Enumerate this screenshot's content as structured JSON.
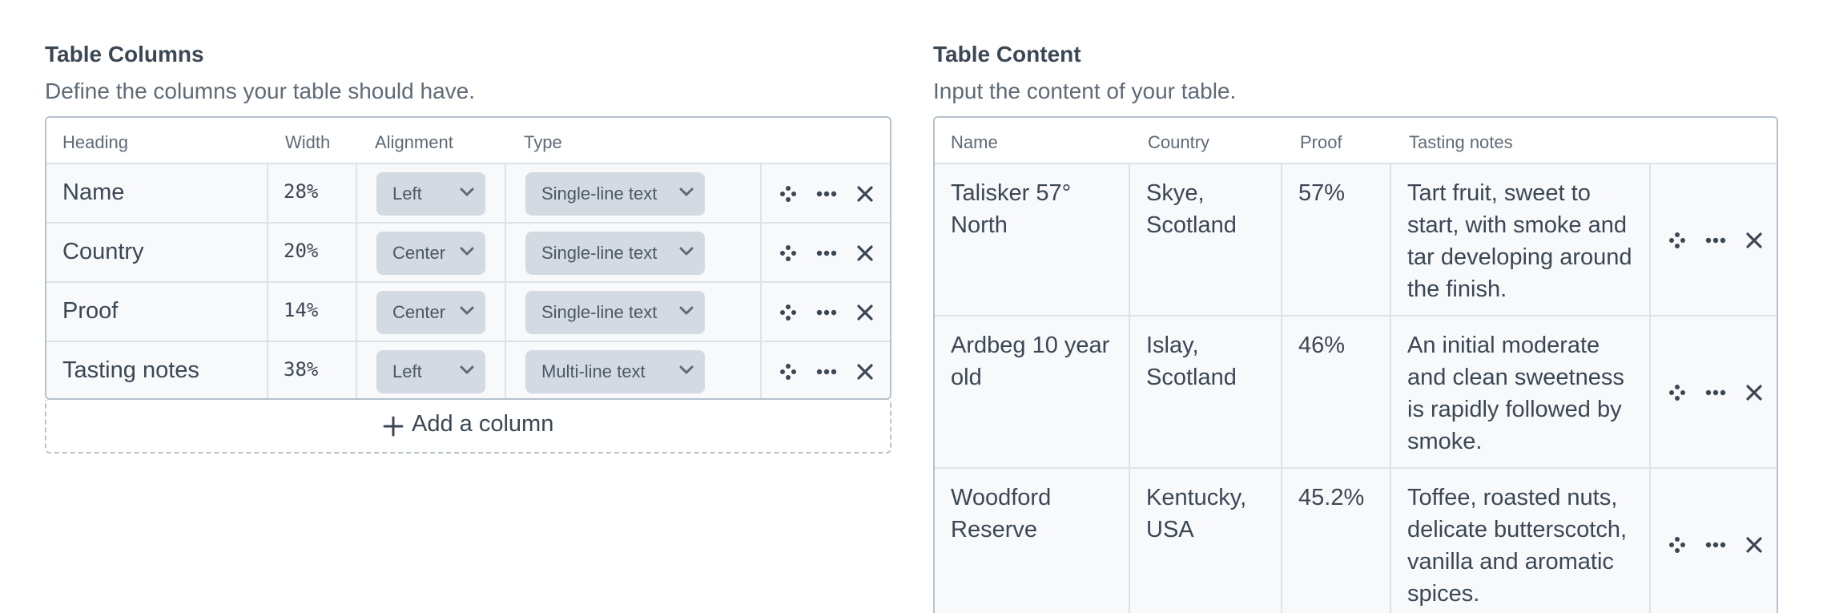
{
  "columns_panel": {
    "title": "Table Columns",
    "description": "Define the columns your table should have.",
    "headers": {
      "heading": "Heading",
      "width": "Width",
      "alignment": "Alignment",
      "type": "Type"
    },
    "rows": [
      {
        "heading": "Name",
        "width": "28%",
        "alignment": "Left",
        "type": "Single-line text"
      },
      {
        "heading": "Country",
        "width": "20%",
        "alignment": "Center",
        "type": "Single-line text"
      },
      {
        "heading": "Proof",
        "width": "14%",
        "alignment": "Center",
        "type": "Single-line text"
      },
      {
        "heading": "Tasting notes",
        "width": "38%",
        "alignment": "Left",
        "type": "Multi-line text"
      }
    ],
    "add_column_label": "Add a column"
  },
  "content_panel": {
    "title": "Table Content",
    "description": "Input the content of your table.",
    "headers": {
      "name": "Name",
      "country": "Country",
      "proof": "Proof",
      "tasting_notes": "Tasting notes"
    },
    "rows": [
      {
        "name": "Talisker 57° North",
        "country": "Skye, Scotland",
        "proof": "57%",
        "tasting_notes": "Tart fruit, sweet to start, with smoke and tar developing around the finish."
      },
      {
        "name": "Ardbeg 10 year old",
        "country": "Islay, Scotland",
        "proof": "46%",
        "tasting_notes": "An initial moderate and clean sweetness is rapidly followed by smoke."
      },
      {
        "name": "Woodford Reserve",
        "country": "Kentucky, USA",
        "proof": "45.2%",
        "tasting_notes": "Toffee, roasted nuts, delicate butterscotch, vanilla and aromatic spices."
      }
    ]
  },
  "icons": {
    "move": "move-icon",
    "more": "more-icon",
    "remove": "close-icon",
    "dropdown": "chevron-down-icon",
    "add": "plus-icon"
  },
  "colors": {
    "border": "#b6c2cd",
    "select_bg": "#d3dae1",
    "row_bg": "#f8f9fb",
    "text": "#3b4754"
  }
}
